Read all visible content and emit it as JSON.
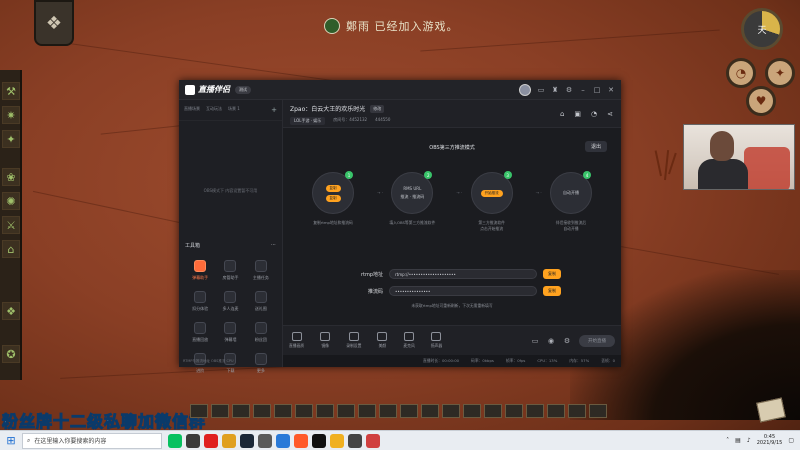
{
  "game": {
    "announcement": "鄭雨 已经加入游戏。",
    "fan_text": "粉丝牌十二级私聊加微信群",
    "clock_label": "天"
  },
  "app": {
    "logo": "直播伴侣",
    "version": "测试",
    "window_controls": [
      "minimize-icon",
      "maximize-icon",
      "close-icon"
    ],
    "left": {
      "tabs": [
        "直播场景",
        "互动玩法",
        "场景 1"
      ],
      "scene_hint": "OBS模式下 内容设置暂不可用",
      "tools_title": "工具箱",
      "tools": [
        {
          "label": "弹幕助手",
          "active": true
        },
        {
          "label": "房管助手"
        },
        {
          "label": "主播任务"
        },
        {
          "label": "扣分体验"
        },
        {
          "label": "多人连麦"
        },
        {
          "label": "送礼图"
        },
        {
          "label": "直播回放"
        },
        {
          "label": "弹幕墙"
        },
        {
          "label": "粉丝团"
        },
        {
          "label": "进阶"
        },
        {
          "label": "下载"
        },
        {
          "label": "更多"
        }
      ],
      "footer": "RTMP与推流地址 OBS推流 CPU"
    },
    "room": {
      "title": "Zpao：白云大王的欢乐时光",
      "tag": "修改",
      "category": "LOL手游 · 娱乐",
      "id": "房间号：4452132",
      "fans": "444550"
    },
    "obs": {
      "title": "OBS第三方推流模式",
      "exit": "退出",
      "steps": [
        {
          "num": "1",
          "buttons": [
            "复制",
            "复制"
          ],
          "desc": "复制rtmp地址和推流码"
        },
        {
          "num": "2",
          "lines": [
            "RMS URL",
            "推流 · 推流码"
          ],
          "desc": "填入OBS等第三方推流软件"
        },
        {
          "num": "3",
          "buttons": [
            "开始推流"
          ],
          "desc": "第三方推流软件\n点击开始推流"
        },
        {
          "num": "4",
          "lines": [
            "自动开播"
          ],
          "desc": "伴侣接收到推流后\n自动开播"
        }
      ],
      "rtmp_label": "rtmp地址",
      "rtmp_value": "rtmp://••••••••••••••••••••",
      "key_label": "推流码",
      "key_value": "•••••••••••••••",
      "copy_label": "复制",
      "hint": "未获取rtmp地址可重新刷新，下次无需重新填写"
    },
    "bottom_tools": [
      "直播画质",
      "镜像",
      "录制设置",
      "美颜",
      "麦克风",
      "扬声器"
    ],
    "start_label": "开始直播",
    "status": [
      "直播时长：00:00:00",
      "码率：0kbps",
      "帧率：0fps",
      "CPU：13%",
      "内存：57%",
      "丢帧：0"
    ]
  },
  "taskbar": {
    "search_placeholder": "在这里输入你要搜索的内容",
    "time": "0:45",
    "date": "2021/9/15"
  }
}
